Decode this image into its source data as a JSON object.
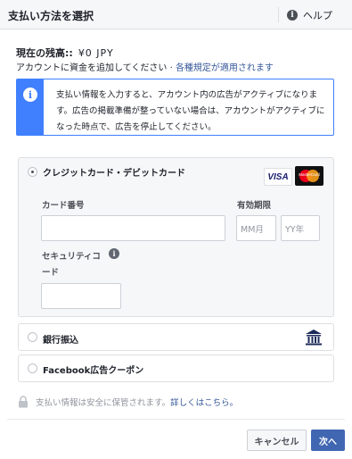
{
  "header": {
    "title": "支払い方法を選択",
    "help_label": "ヘルプ"
  },
  "balance": {
    "label": "現在の残高::",
    "amount": "¥0 JPY"
  },
  "add_funds": {
    "text": "アカウントに資金を追加してください · ",
    "link": "各種規定が適用されます"
  },
  "notice": {
    "text": "支払い情報を入力すると、アカウント内の広告がアクティブになります。広告の掲載準備が整っていない場合は、アカウントがアクティブになった時点で、広告を停止してください。"
  },
  "card_option": {
    "label": "クレジットカード・デビットカード",
    "selected": true,
    "brands": [
      "VISA",
      "MasterCard"
    ],
    "card_number_label": "カード番号",
    "card_number_value": "",
    "expiry_label": "有効期限",
    "month_placeholder": "MM月",
    "year_placeholder": "YY年",
    "security_code_label_1": "セキュリティコ",
    "security_code_label_2": "ード",
    "security_code_value": ""
  },
  "bank_option": {
    "label": "銀行振込",
    "icon": "bank-icon"
  },
  "coupon_option": {
    "label": "Facebook広告クーポン"
  },
  "secure_note": {
    "text": "支払い情報は安全に保管されます。",
    "link": "詳しくはこちら。"
  },
  "buttons": {
    "cancel": "キャンセル",
    "next": "次へ"
  },
  "colors": {
    "primary": "#4267b2",
    "notice_blue": "#4080ff",
    "link": "#365899"
  }
}
